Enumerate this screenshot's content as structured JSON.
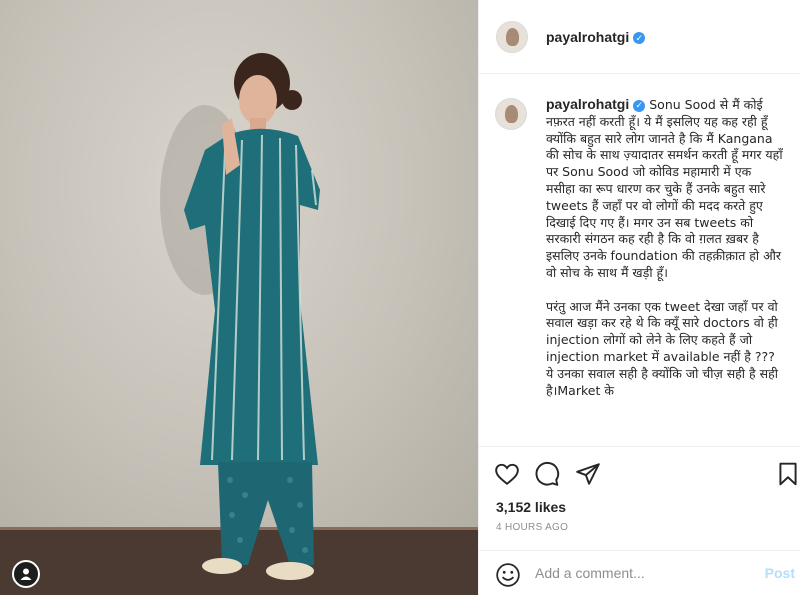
{
  "post": {
    "username": "payalrohatgi",
    "verified": true,
    "caption": "Sonu Sood से मैं कोई नफ़रत नहीं करती हूँ। ये मैं इसलिए यह कह रही हूँ क्योंकि बहुत सारे लोग जानते है कि मैं Kangana की सोच के साथ ज़्यादातर समर्थन करती हूँ मगर यहाँ पर Sonu Sood जो कोविड महामारी में एक मसीहा का रूप धारण कर चुके हैं उनके बहुत सारे tweets हैं जहाँ पर वो लोगों की मदद करते हुए दिखाई दिए गए हैं। मगर उन सब tweets को सरकारी संगठन कह रही है कि वो ग़लत ख़बर है इसलिए उनके foundation की तहक़ीक़ात हो और वो सोच के साथ मैं खड़ी हूँ।\n\nपरंतु आज मैंने उनका एक tweet देखा जहाँ पर वो सवाल खड़ा कर रहे थे कि क्यूँ सारे doctors वो ही injection लोगों को लेने के लिए कहते हैं जो injection market में available नहीं है ??? ये उनका सवाल सही है क्योंकि जो चीज़ सही है सही है।Market के",
    "likes": "3,152 likes",
    "time": "4 HOURS AGO"
  },
  "comment": {
    "placeholder": "Add a comment...",
    "post_label": "Post"
  },
  "icons": [
    "heart-icon",
    "comment-icon",
    "share-icon",
    "bookmark-icon",
    "emoji-icon",
    "user-tag-icon"
  ],
  "colors": {
    "verified": "#3897f0",
    "post_button": "#b2dffc",
    "dress": "#1f6f7a"
  }
}
